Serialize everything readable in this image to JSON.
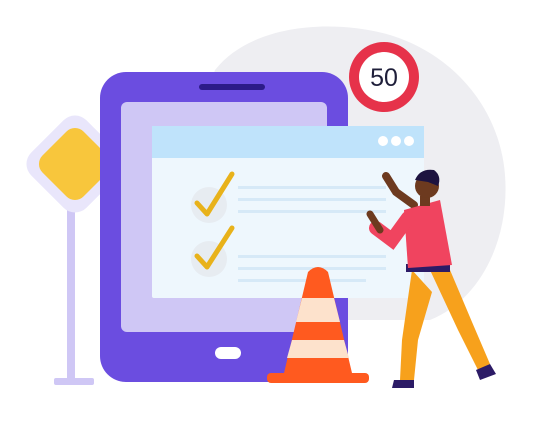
{
  "illustration": {
    "speed_limit_value": "50",
    "checklist_items": [
      {
        "checked": true
      },
      {
        "checked": true
      }
    ],
    "window_control_dots": 3,
    "icons": [
      "diamond-road-sign-icon",
      "speed-limit-sign-icon",
      "traffic-cone-icon",
      "checkmark-icon",
      "tablet-icon",
      "person-icon"
    ],
    "colors": {
      "tablet_body": "#6b4de0",
      "tablet_screen": "#cfc7f5",
      "window_bar": "#bfe3fb",
      "window_body": "#eef7fd",
      "checkmark": "#e8b21a",
      "road_sign_fill": "#f8c63c",
      "speed_sign_ring": "#e6324a",
      "cone": "#ff5a1f",
      "person_shirt": "#f0445f",
      "person_pants": "#f7a11c",
      "background_blob": "#eeeef2"
    }
  }
}
